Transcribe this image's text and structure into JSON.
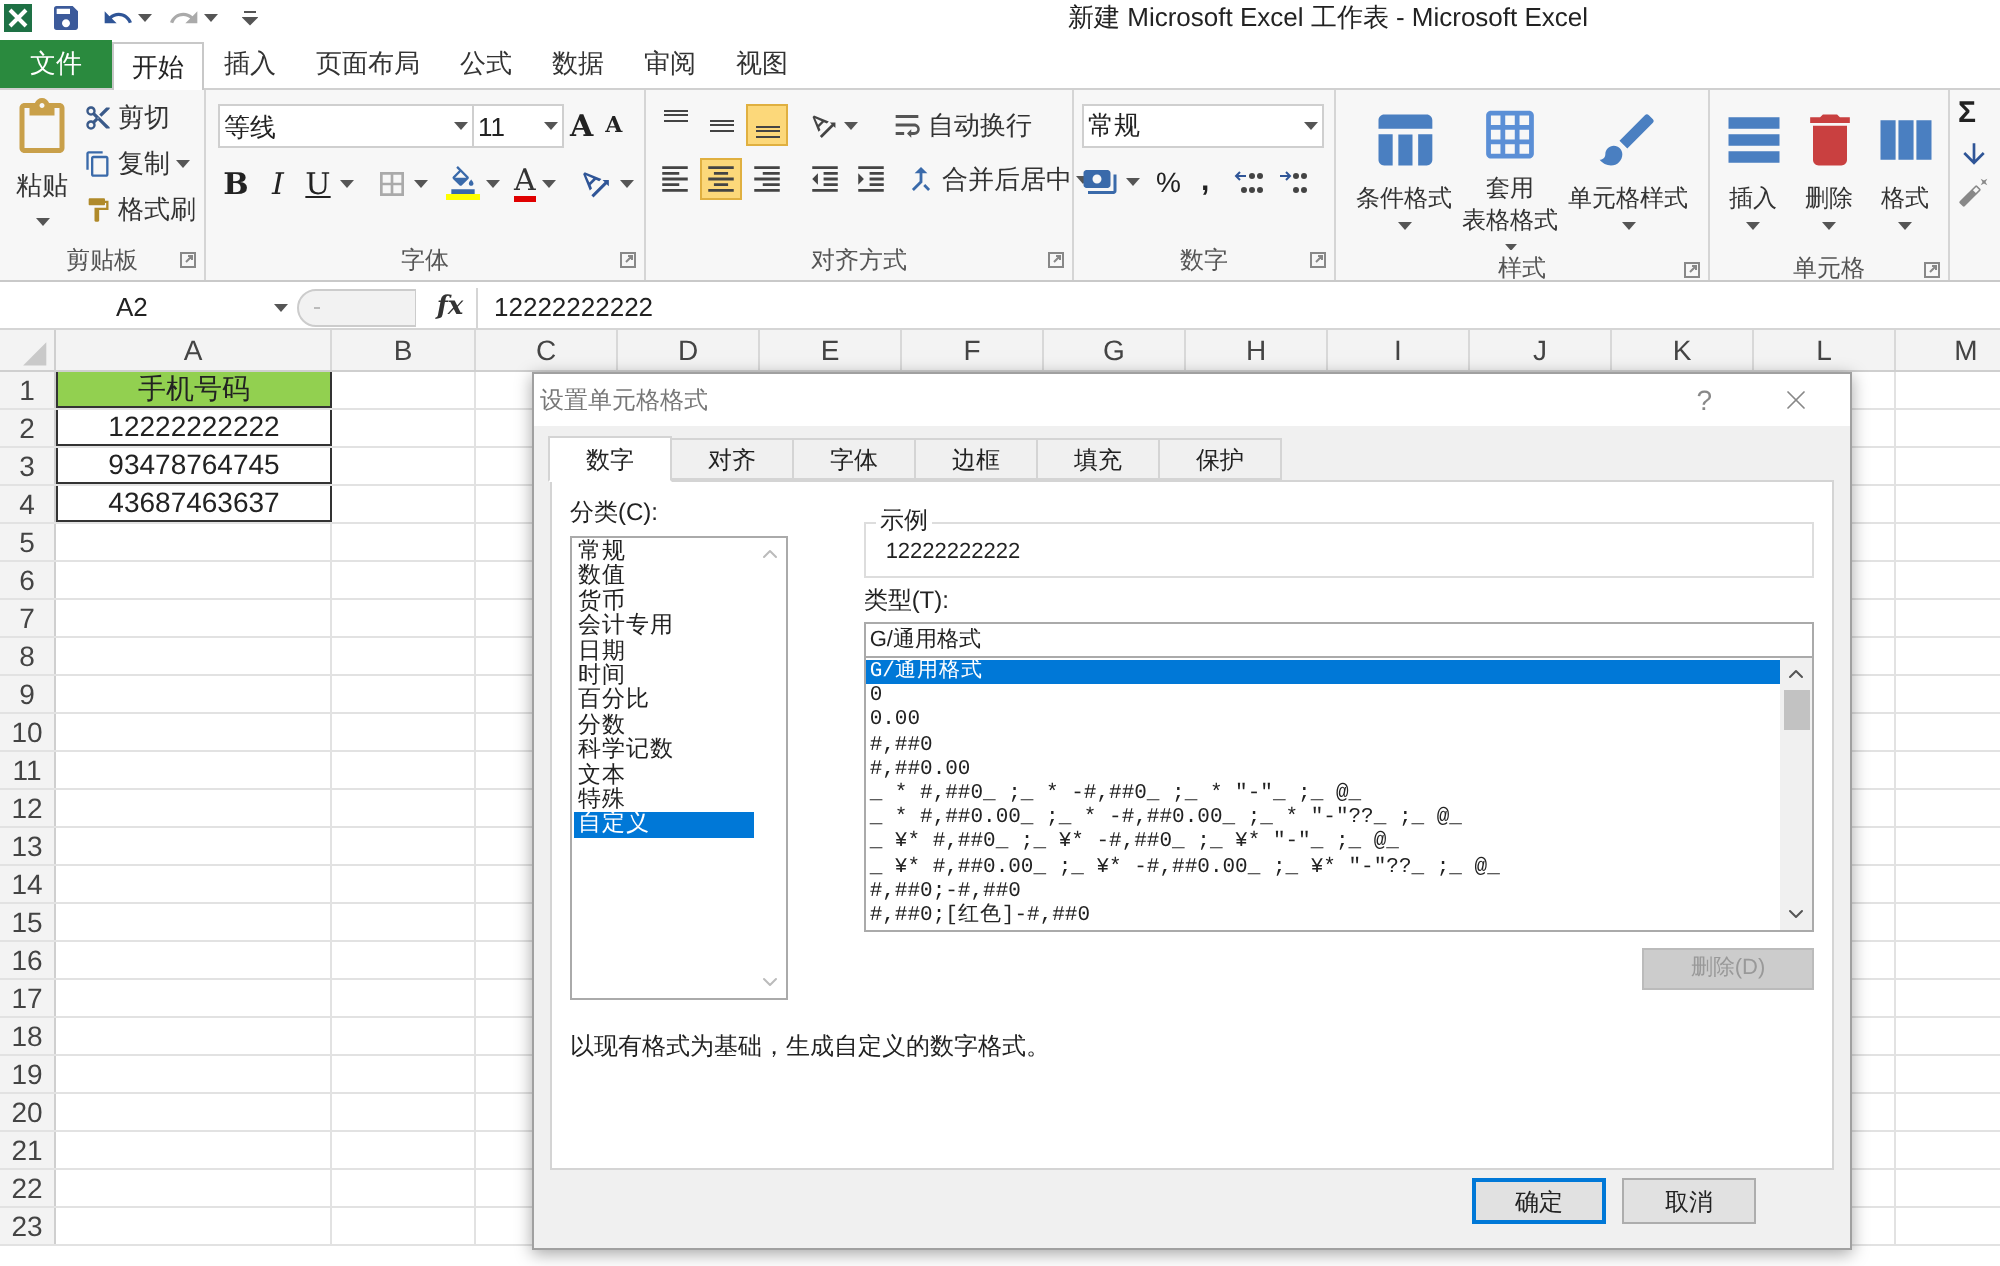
{
  "window": {
    "title": "新建 Microsoft Excel 工作表 - Microsoft Excel"
  },
  "ribbon_tabs": [
    {
      "label": "文件",
      "kind": "file",
      "selected": false
    },
    {
      "label": "开始",
      "kind": "tab",
      "selected": true
    },
    {
      "label": "插入",
      "kind": "tab",
      "selected": false
    },
    {
      "label": "页面布局",
      "kind": "tab",
      "selected": false
    },
    {
      "label": "公式",
      "kind": "tab",
      "selected": false
    },
    {
      "label": "数据",
      "kind": "tab",
      "selected": false
    },
    {
      "label": "审阅",
      "kind": "tab",
      "selected": false
    },
    {
      "label": "视图",
      "kind": "tab",
      "selected": false
    }
  ],
  "clipboard": {
    "label": "剪贴板",
    "paste": "粘贴",
    "cut": "剪切",
    "copy": "复制",
    "format_painter": "格式刷"
  },
  "font": {
    "label": "字体",
    "name": "等线",
    "size": "11",
    "grow": "A",
    "shrink": "A",
    "bold": "B",
    "italic": "I",
    "underline": "U",
    "font_color": "A"
  },
  "alignment": {
    "label": "对齐方式",
    "vertical": [
      {
        "kind": "top",
        "selected": false
      },
      {
        "kind": "middle",
        "selected": false
      },
      {
        "kind": "bottom",
        "selected": true
      }
    ],
    "horizontal": [
      {
        "kind": "left",
        "selected": false
      },
      {
        "kind": "center",
        "selected": true
      },
      {
        "kind": "right",
        "selected": false
      }
    ],
    "wrap_text": "自动换行",
    "merge_center": "合并后居中"
  },
  "number": {
    "label": "数字",
    "format": "常规",
    "percent": "%",
    "comma": ","
  },
  "styles": {
    "label": "样式",
    "commands": [
      {
        "kind": "conditional",
        "lines": [
          "条件格式"
        ]
      },
      {
        "kind": "table",
        "lines": [
          "套用",
          "表格格式"
        ]
      },
      {
        "kind": "cell",
        "lines": [
          "单元格样式"
        ]
      }
    ]
  },
  "cells": {
    "label": "单元格",
    "commands": [
      {
        "kind": "insert",
        "lines": [
          "插入"
        ]
      },
      {
        "kind": "delete",
        "lines": [
          "删除"
        ]
      },
      {
        "kind": "format",
        "lines": [
          "格式"
        ]
      }
    ]
  },
  "editing": {
    "sum": "Σ"
  },
  "formula_bar": {
    "name_box": "A2",
    "function_label": "fx",
    "value": "12222222222"
  },
  "sheet": {
    "columns": [
      "A",
      "B",
      "C",
      "D",
      "E",
      "F",
      "G",
      "H",
      "I",
      "J",
      "K",
      "L",
      "M"
    ],
    "rows": [
      {
        "number": "1",
        "cell_a": "手机号码",
        "highlighted": true
      },
      {
        "number": "2",
        "cell_a": "12222222222",
        "highlighted": false
      },
      {
        "number": "3",
        "cell_a": "93478764745",
        "highlighted": false
      },
      {
        "number": "4",
        "cell_a": "43687463637",
        "highlighted": false
      },
      {
        "number": "5"
      },
      {
        "number": "6"
      },
      {
        "number": "7"
      },
      {
        "number": "8"
      },
      {
        "number": "9"
      },
      {
        "number": "10"
      },
      {
        "number": "11"
      },
      {
        "number": "12"
      },
      {
        "number": "13"
      },
      {
        "number": "14"
      },
      {
        "number": "15"
      },
      {
        "number": "16"
      },
      {
        "number": "17"
      },
      {
        "number": "18"
      },
      {
        "number": "19"
      },
      {
        "number": "20"
      },
      {
        "number": "21"
      },
      {
        "number": "22"
      },
      {
        "number": "23"
      }
    ]
  },
  "dialog": {
    "title": "设置单元格格式",
    "help": "?",
    "tabs": [
      {
        "label": "数字",
        "selected": true
      },
      {
        "label": "对齐",
        "selected": false
      },
      {
        "label": "字体",
        "selected": false
      },
      {
        "label": "边框",
        "selected": false
      },
      {
        "label": "填充",
        "selected": false
      },
      {
        "label": "保护",
        "selected": false
      }
    ],
    "category_label": "分类(C):",
    "categories": [
      {
        "label": "常规",
        "selected": false
      },
      {
        "label": "数值",
        "selected": false
      },
      {
        "label": "货币",
        "selected": false
      },
      {
        "label": "会计专用",
        "selected": false
      },
      {
        "label": "日期",
        "selected": false
      },
      {
        "label": "时间",
        "selected": false
      },
      {
        "label": "百分比",
        "selected": false
      },
      {
        "label": "分数",
        "selected": false
      },
      {
        "label": "科学记数",
        "selected": false
      },
      {
        "label": "文本",
        "selected": false
      },
      {
        "label": "特殊",
        "selected": false
      },
      {
        "label": "自定义",
        "selected": true
      }
    ],
    "sample_label": "示例",
    "sample_value": "12222222222",
    "type_label": "类型(T):",
    "type_value": "G/通用格式",
    "formats": [
      {
        "label": "G/通用格式",
        "selected": true
      },
      {
        "label": "0",
        "selected": false
      },
      {
        "label": "0.00",
        "selected": false
      },
      {
        "label": "#,##0",
        "selected": false
      },
      {
        "label": "#,##0.00",
        "selected": false
      },
      {
        "label": "_ * #,##0_ ;_ * -#,##0_ ;_ * \"-\"_ ;_ @_",
        "selected": false
      },
      {
        "label": "_ * #,##0.00_ ;_ * -#,##0.00_ ;_ * \"-\"??_ ;_ @_",
        "selected": false
      },
      {
        "label": "_ ¥* #,##0_ ;_ ¥* -#,##0_ ;_ ¥* \"-\"_ ;_ @_",
        "selected": false
      },
      {
        "label": "_ ¥* #,##0.00_ ;_ ¥* -#,##0.00_ ;_ ¥* \"-\"??_ ;_ @_",
        "selected": false
      },
      {
        "label": "#,##0;-#,##0",
        "selected": false
      },
      {
        "label": "#,##0;[红色]-#,##0",
        "selected": false
      }
    ],
    "delete_button": {
      "label": "删除(D)",
      "disabled": true
    },
    "description": "以现有格式为基础，生成自定义的数字格式。",
    "buttons": [
      {
        "label": "确定",
        "default": true
      },
      {
        "label": "取消",
        "default": false
      }
    ]
  }
}
